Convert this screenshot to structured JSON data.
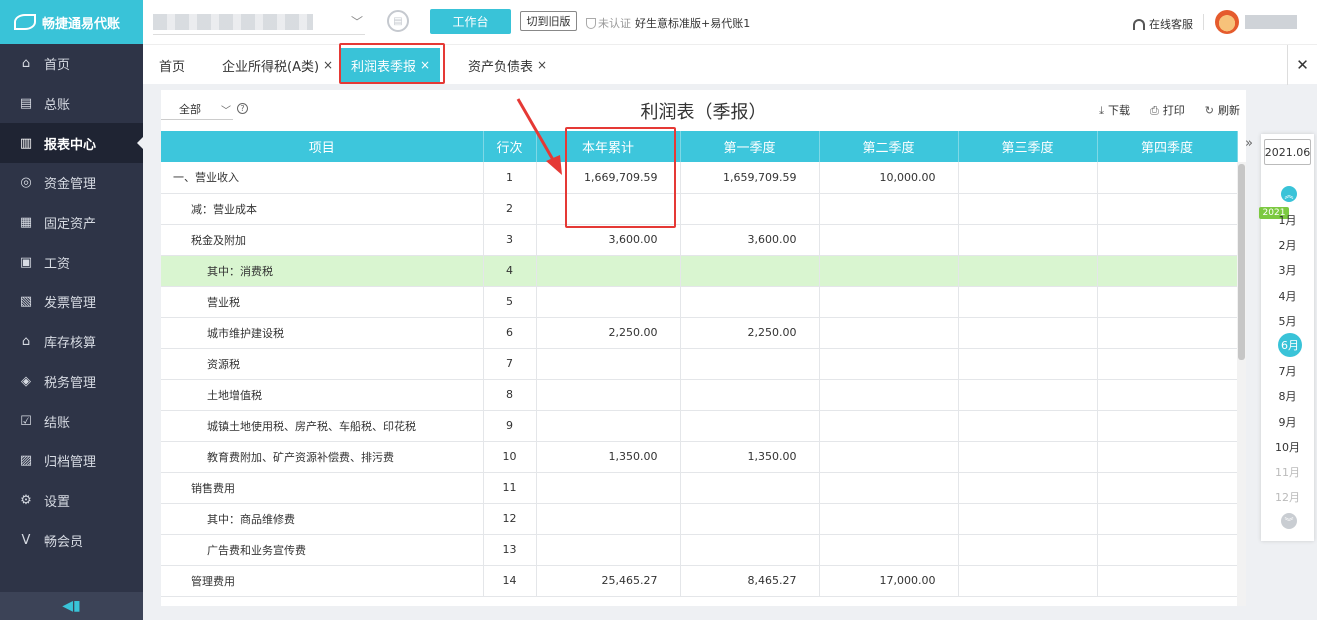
{
  "app": {
    "name": "畅捷通易代账"
  },
  "sidebar": {
    "items": [
      {
        "label": "首页",
        "icon": "home-icon"
      },
      {
        "label": "总账",
        "icon": "ledger-icon"
      },
      {
        "label": "报表中心",
        "icon": "chart-icon",
        "active": true
      },
      {
        "label": "资金管理",
        "icon": "money-icon"
      },
      {
        "label": "固定资产",
        "icon": "building-icon"
      },
      {
        "label": "工资",
        "icon": "payroll-icon"
      },
      {
        "label": "发票管理",
        "icon": "invoice-icon"
      },
      {
        "label": "库存核算",
        "icon": "warehouse-icon"
      },
      {
        "label": "税务管理",
        "icon": "tax-icon"
      },
      {
        "label": "结账",
        "icon": "checkout-icon"
      },
      {
        "label": "归档管理",
        "icon": "archive-icon"
      },
      {
        "label": "设置",
        "icon": "gear-icon"
      },
      {
        "label": "畅会员",
        "icon": "vip-icon"
      }
    ]
  },
  "topbar": {
    "workbench_label": "工作台",
    "switch_old_label": "切到旧版",
    "cert_label": "未认证",
    "plan_label": "好生意标准版+易代账1",
    "support_label": "在线客服"
  },
  "tabs": [
    {
      "label": "首页",
      "closable": false
    },
    {
      "label": "企业所得税(A类)",
      "closable": true
    },
    {
      "label": "利润表季报",
      "closable": true,
      "active": true
    },
    {
      "label": "资产负债表",
      "closable": true
    }
  ],
  "toolbar": {
    "filter_value": "全部",
    "title": "利润表（季报）",
    "download_label": "下载",
    "print_label": "打印",
    "refresh_label": "刷新"
  },
  "table": {
    "columns": [
      "项目",
      "行次",
      "本年累计",
      "第一季度",
      "第二季度",
      "第三季度",
      "第四季度"
    ],
    "rows": [
      {
        "item": "一、营业收入",
        "level": 1,
        "line": "1",
        "ytd": "1,669,709.59",
        "q1": "1,659,709.59",
        "q2": "10,000.00",
        "q3": "",
        "q4": ""
      },
      {
        "item": "减：营业成本",
        "level": 2,
        "line": "2",
        "ytd": "",
        "q1": "",
        "q2": "",
        "q3": "",
        "q4": ""
      },
      {
        "item": "税金及附加",
        "level": 2,
        "line": "3",
        "ytd": "3,600.00",
        "q1": "3,600.00",
        "q2": "",
        "q3": "",
        "q4": ""
      },
      {
        "item": "其中：消费税",
        "level": 3,
        "line": "4",
        "ytd": "",
        "q1": "",
        "q2": "",
        "q3": "",
        "q4": "",
        "highlight": true
      },
      {
        "item": "营业税",
        "level": 3,
        "line": "5",
        "ytd": "",
        "q1": "",
        "q2": "",
        "q3": "",
        "q4": ""
      },
      {
        "item": "城市维护建设税",
        "level": 3,
        "line": "6",
        "ytd": "2,250.00",
        "q1": "2,250.00",
        "q2": "",
        "q3": "",
        "q4": ""
      },
      {
        "item": "资源税",
        "level": 3,
        "line": "7",
        "ytd": "",
        "q1": "",
        "q2": "",
        "q3": "",
        "q4": ""
      },
      {
        "item": "土地增值税",
        "level": 3,
        "line": "8",
        "ytd": "",
        "q1": "",
        "q2": "",
        "q3": "",
        "q4": ""
      },
      {
        "item": "城镇土地使用税、房产税、车船税、印花税",
        "level": 3,
        "line": "9",
        "ytd": "",
        "q1": "",
        "q2": "",
        "q3": "",
        "q4": ""
      },
      {
        "item": "教育费附加、矿产资源补偿费、排污费",
        "level": 3,
        "line": "10",
        "ytd": "1,350.00",
        "q1": "1,350.00",
        "q2": "",
        "q3": "",
        "q4": ""
      },
      {
        "item": "销售费用",
        "level": 2,
        "line": "11",
        "ytd": "",
        "q1": "",
        "q2": "",
        "q3": "",
        "q4": ""
      },
      {
        "item": "其中：商品维修费",
        "level": 3,
        "line": "12",
        "ytd": "",
        "q1": "",
        "q2": "",
        "q3": "",
        "q4": ""
      },
      {
        "item": "广告费和业务宣传费",
        "level": 3,
        "line": "13",
        "ytd": "",
        "q1": "",
        "q2": "",
        "q3": "",
        "q4": ""
      },
      {
        "item": "管理费用",
        "level": 2,
        "line": "14",
        "ytd": "25,465.27",
        "q1": "8,465.27",
        "q2": "17,000.00",
        "q3": "",
        "q4": ""
      }
    ]
  },
  "period": {
    "selected": "2021.06",
    "year_badge": "2021",
    "months": [
      {
        "label": "1月",
        "state": "normal"
      },
      {
        "label": "2月",
        "state": "normal"
      },
      {
        "label": "3月",
        "state": "normal"
      },
      {
        "label": "4月",
        "state": "normal"
      },
      {
        "label": "5月",
        "state": "normal"
      },
      {
        "label": "6月",
        "state": "active"
      },
      {
        "label": "7月",
        "state": "normal"
      },
      {
        "label": "8月",
        "state": "normal"
      },
      {
        "label": "9月",
        "state": "normal"
      },
      {
        "label": "10月",
        "state": "normal"
      },
      {
        "label": "11月",
        "state": "disabled"
      },
      {
        "label": "12月",
        "state": "disabled"
      }
    ]
  },
  "colors": {
    "accent": "#39c3d8",
    "sidebar_bg": "#2e3447",
    "highlight_row": "#d9f5d0",
    "annotation": "#e53935"
  }
}
